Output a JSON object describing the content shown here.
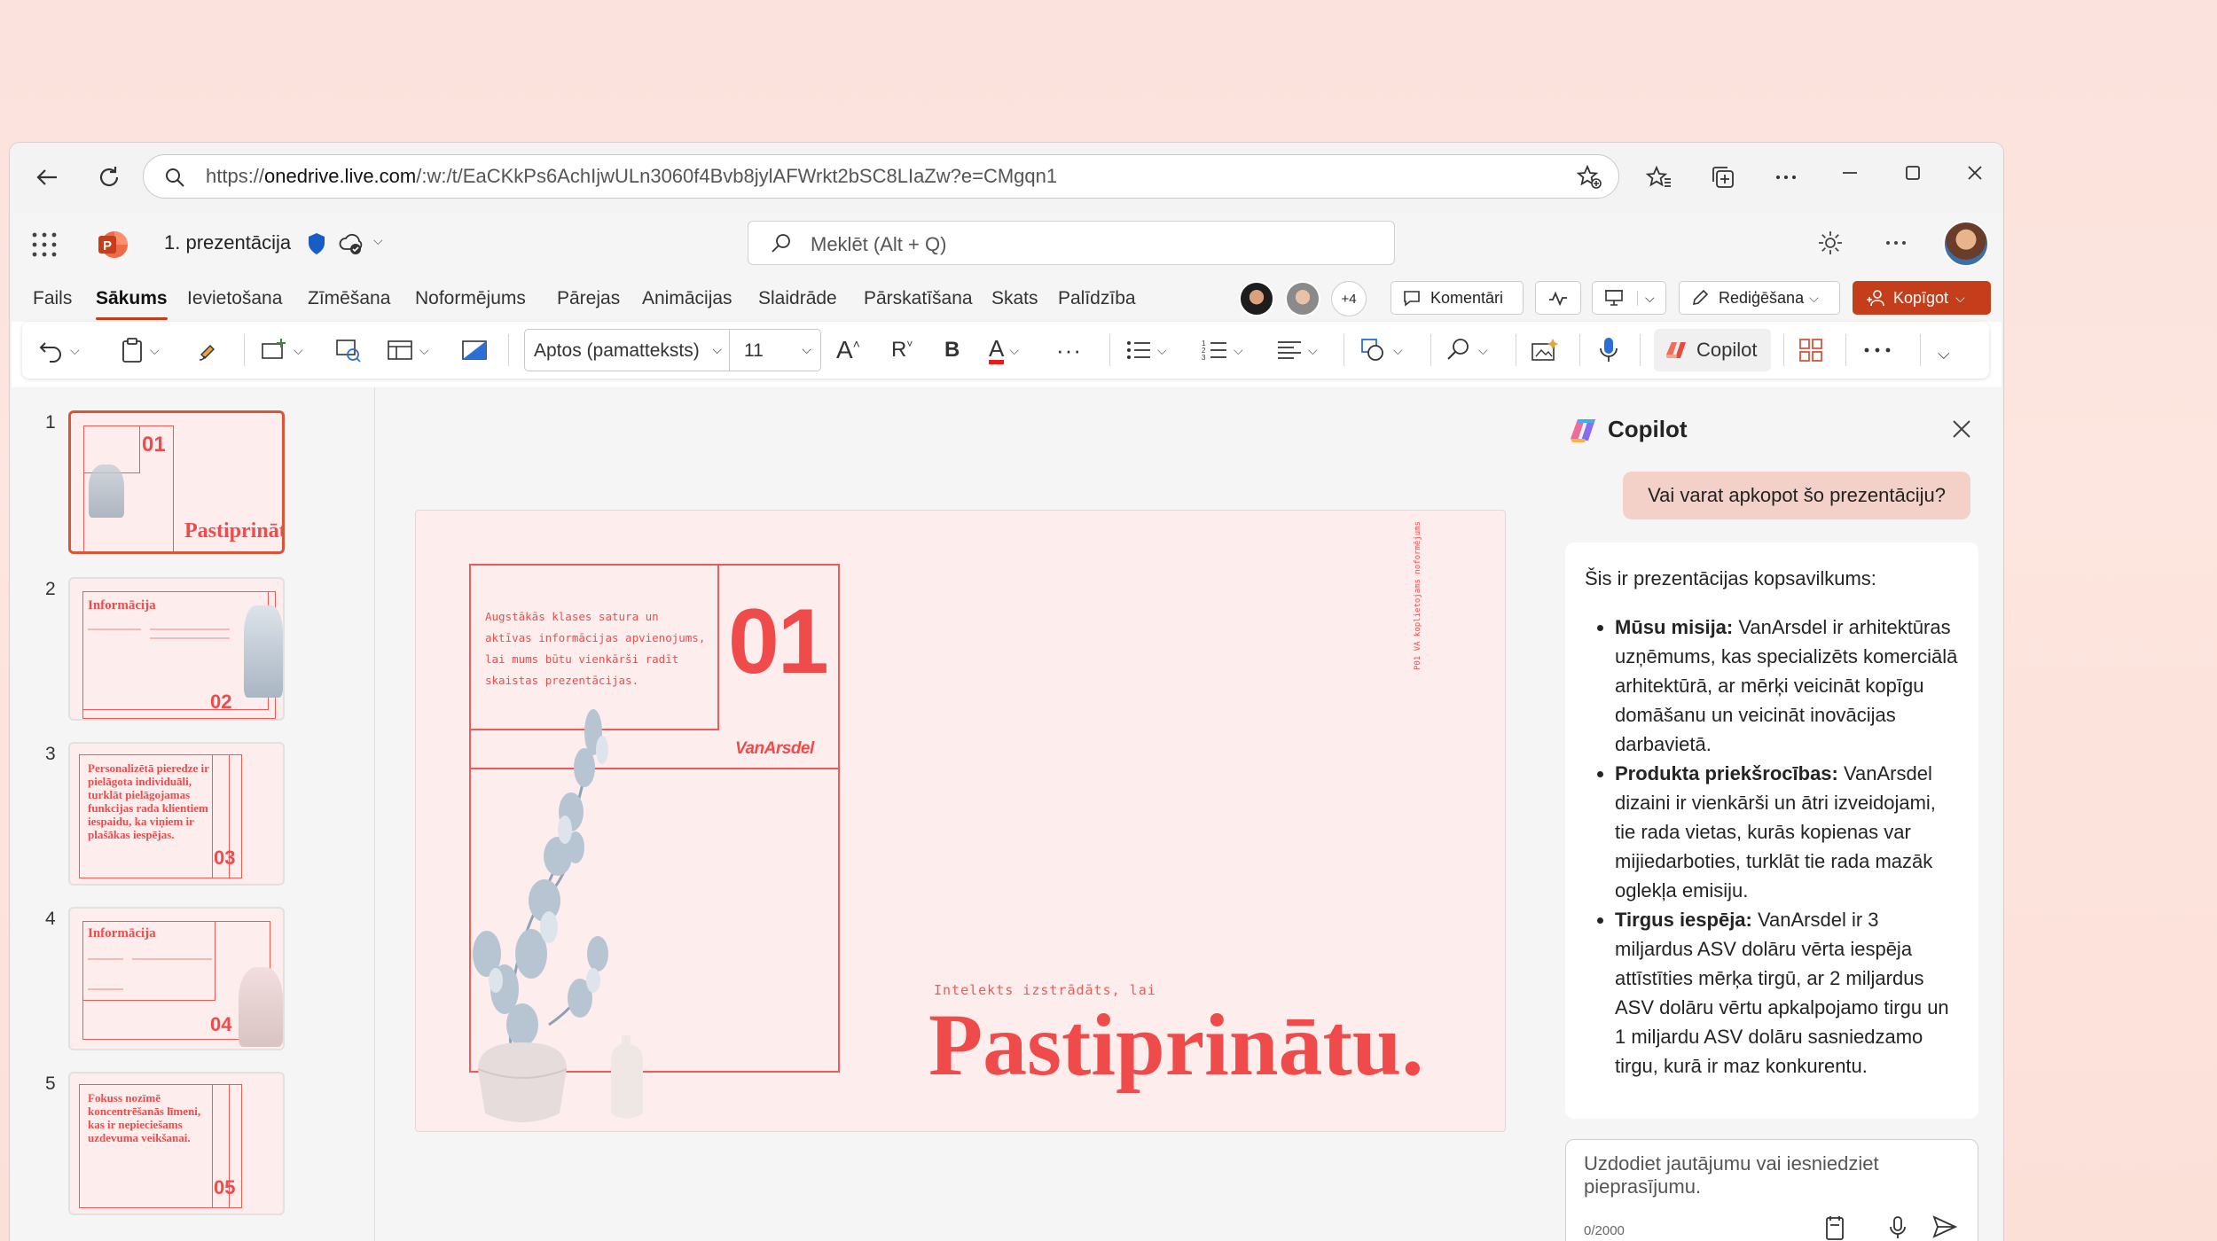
{
  "browser": {
    "url_prefix": "https://",
    "url_host": "onedrive.live.com",
    "url_rest": "/:w:/t/EaCKkPs6AchIjwULn3060f4Bvb8jylAFWrkt2bSC8LIaZw?e=CMgqn1"
  },
  "header": {
    "doc_title": "1. prezentācija",
    "search_placeholder": "Meklēt (Alt + Q)",
    "presence_more": "+4"
  },
  "ribbon_tabs": [
    "Fails",
    "Sākums",
    "Ievietošana",
    "Zīmēšana",
    "Noformējums",
    "Pārejas",
    "Animācijas",
    "Slaidrāde",
    "Pārskatīšana",
    "Skats",
    "Palīdzība"
  ],
  "header_buttons": {
    "comments": "Komentāri",
    "editing": "Rediģēšana",
    "share": "Kopīgot"
  },
  "toolbar": {
    "font_name": "Aptos (pamatteksts)",
    "font_size": "11",
    "grow_font": "A",
    "shrink_font": "R",
    "bold": "B",
    "font_color": "A",
    "more": "···",
    "copilot": "Copilot"
  },
  "thumbnails": [
    {
      "num": "1",
      "title": "Pastiprināt.",
      "tnum": "01"
    },
    {
      "num": "2",
      "title": "Informācija",
      "tnum": "02"
    },
    {
      "num": "3",
      "title": "Personalizētā pieredze ir pielāgota individuāli, turklāt pielāgojamas funkcijas rada klientiem iespaidu, ka viņiem ir plašākas iespējas.",
      "tnum": "03"
    },
    {
      "num": "4",
      "title": "Informācija",
      "tnum": "04"
    },
    {
      "num": "5",
      "title": "Fokuss nozīmē koncentrēšanās līmeni, kas ir nepieciešams uzdevuma veikšanai.",
      "tnum": "05"
    }
  ],
  "slide": {
    "intro_text": "Augstākās klases satura un aktīvas informācijas apvienojums, lai mums būtu vienkārši radīt skaistas prezentācijas.",
    "number": "01",
    "brand": "VanArsdel",
    "side_text": "P01 VA koplietojams noformējums",
    "subtitle": "Intelekts izstrādāts, lai",
    "title": "Pastiprinātu."
  },
  "copilot": {
    "title": "Copilot",
    "user_message": "Vai varat apkopot šo prezentāciju?",
    "response_intro": "Šis ir prezentācijas kopsavilkums:",
    "items": [
      {
        "label": "Mūsu misija:",
        "text": " VanArsdel ir arhitektūras uzņēmums, kas specializēts komerciālā arhitektūrā, ar mērķi veicināt kopīgu domāšanu un veicināt inovācijas darbavietā."
      },
      {
        "label": "Produkta priekšrocības:",
        "text": " VanArsdel dizaini ir vienkārši un ātri izveidojami, tie rada vietas, kurās kopienas var mijiedarboties, turklāt tie rada mazāk oglekļa emisiju."
      },
      {
        "label": "Tirgus iespēja:",
        "text": " VanArsdel ir 3 miljardus ASV dolāru vērta iespēja attīstīties mērķa tirgū, ar 2 miljardus ASV dolāru vērtu apkalpojamo tirgu un 1 miljardu ASV dolāru sasniedzamo tirgu, kurā ir maz konkurentu."
      }
    ],
    "input_placeholder": "Uzdodiet jautājumu vai iesniedziet pieprasījumu.",
    "char_count": "0/2000"
  },
  "colors": {
    "accent": "#c43e1c",
    "slide_red": "#ef4b4b",
    "slide_bg": "#fdeeed"
  }
}
